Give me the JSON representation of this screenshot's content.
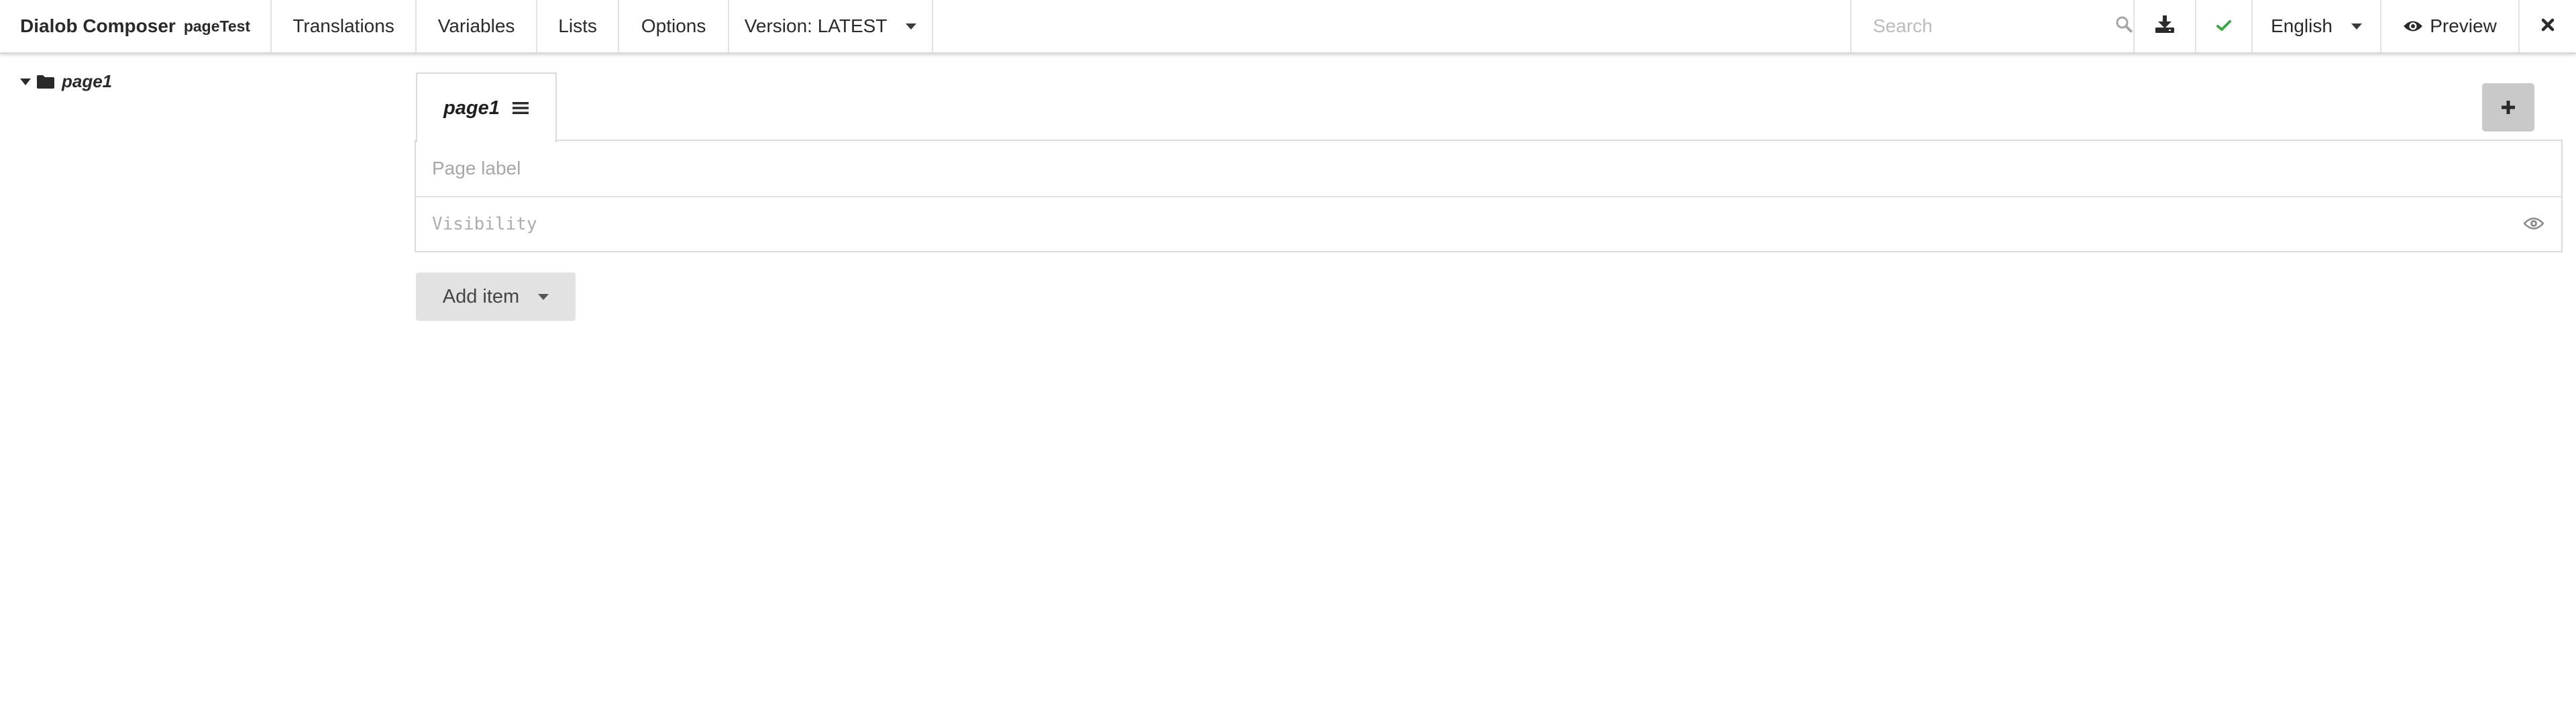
{
  "app": {
    "title": "Dialob Composer",
    "form_name": "pageTest"
  },
  "menu": {
    "translations": "Translations",
    "variables": "Variables",
    "lists": "Lists",
    "options": "Options",
    "version": "Version: LATEST",
    "search_placeholder": "Search",
    "language": "English",
    "preview": "Preview"
  },
  "icons": {
    "search": "search-icon",
    "download": "download-icon",
    "status": "check-icon",
    "preview": "eye-icon",
    "close": "close-icon",
    "tree_folder": "folder-icon",
    "tab_menu": "bars-icon",
    "add_page": "plus-icon",
    "visibility": "eye-icon"
  },
  "colors": {
    "status_ok": "#39a845",
    "add_page_button": "#c9c9c9",
    "add_item_button": "#e2e2e2"
  },
  "tree": {
    "items": [
      {
        "label": "page1",
        "expanded": true
      }
    ]
  },
  "editor": {
    "tab_label": "page1",
    "page_label_placeholder": "Page label",
    "visibility_placeholder": "Visibility",
    "add_item_label": "Add item"
  }
}
